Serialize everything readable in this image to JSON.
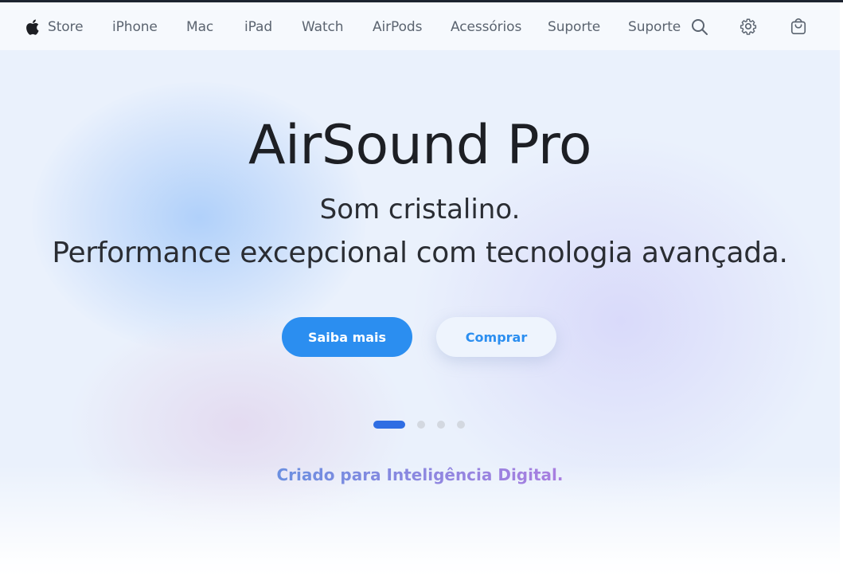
{
  "nav": {
    "logo_icon": "apple-logo-icon",
    "items": [
      {
        "label": "Store"
      },
      {
        "label": "iPhone"
      },
      {
        "label": "Mac"
      },
      {
        "label": "iPad"
      },
      {
        "label": "Watch"
      },
      {
        "label": "AirPods"
      },
      {
        "label": "Acessórios"
      },
      {
        "label": "Suporte"
      },
      {
        "label": "Suporte"
      }
    ],
    "icons": [
      "search-icon",
      "gear-icon",
      "shopping-bag-icon"
    ]
  },
  "hero": {
    "title": "AirSound Pro",
    "subtitle_line1": "Som cristalino.",
    "subtitle_line2": "Performance excepcional com tecnologia avançada.",
    "primary_button": "Saiba mais",
    "secondary_button": "Comprar",
    "carousel": {
      "total": 4,
      "active": 1
    },
    "tagline": "Criado para Inteligência Digital."
  },
  "colors": {
    "accent": "#2b8ef0",
    "active_dot": "#2f6de3",
    "text_dark": "#1d1f24"
  }
}
